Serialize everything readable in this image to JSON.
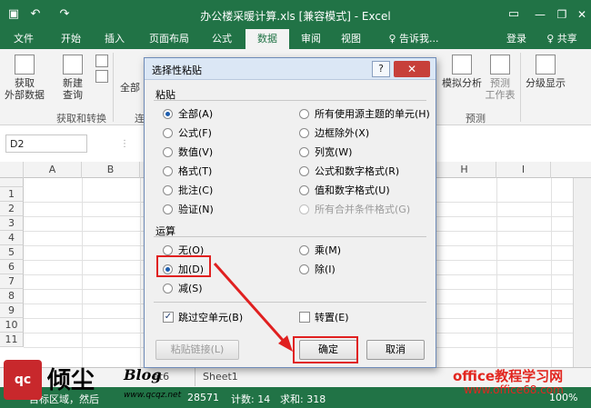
{
  "titlebar": {
    "save_icon": "save-icon",
    "undo_icon": "undo-icon",
    "redo_icon": "redo-icon",
    "title": "办公楼采暖计算.xls  [兼容模式] - Excel",
    "ribbon_display_icon": "ribbon-display-icon",
    "minimize": "—",
    "restore": "❐",
    "close": "✕"
  },
  "tabs": [
    "文件",
    "开始",
    "插入",
    "页面布局",
    "公式",
    "数据",
    "审阅",
    "视图"
  ],
  "tell_me": "♀ 告诉我...",
  "login": "登录",
  "share": "♀ 共享",
  "ribbon": {
    "get_external_data": "获取\n外部数据",
    "new_query": "新建\n查询",
    "refresh_all": "全部",
    "group_get_transform": "获取和转换",
    "group_conn_partial": "连",
    "what_if": "模拟分析",
    "forecast_sheet": "预测\n工作表",
    "group_forecast": "预测",
    "outline": "分级显示"
  },
  "namebox": "D2",
  "columns": [
    "A",
    "B",
    "H",
    "I"
  ],
  "rows": [
    "1",
    "2",
    "3",
    "4",
    "5",
    "6",
    "7",
    "8",
    "9",
    "10",
    "11"
  ],
  "sheet_tabs": [
    "et6",
    "Sheet1"
  ],
  "status": {
    "left": "目标区域，然后",
    "value_partial": "28571",
    "count": "计数: 14",
    "sum": "求和: 318",
    "zoom": "100%"
  },
  "dialog": {
    "title": "选择性粘贴",
    "help": "?",
    "close": "✕",
    "paste_section": "粘贴",
    "paste_options_left": [
      "全部(A)",
      "公式(F)",
      "数值(V)",
      "格式(T)",
      "批注(C)",
      "验证(N)"
    ],
    "paste_options_right": [
      "所有使用源主题的单元(H)",
      "边框除外(X)",
      "列宽(W)",
      "公式和数字格式(R)",
      "值和数字格式(U)",
      "所有合并条件格式(G)"
    ],
    "operation_section": "运算",
    "op_left": [
      "无(O)",
      "加(D)",
      "减(S)"
    ],
    "op_right": [
      "乘(M)",
      "除(I)"
    ],
    "skip_blanks": "跳过空单元(B)",
    "transpose": "转置(E)",
    "paste_link": "粘贴链接(L)",
    "ok": "确定",
    "cancel": "取消"
  },
  "watermarks": {
    "site_name": "office教程学习网",
    "site_url": "www.office68.com",
    "logo_text": "qc",
    "blog_cn": "倾尘",
    "blog_en": "Blog",
    "blog_url": "www.qcqz.net"
  },
  "colors": {
    "excel_green": "#217346",
    "highlight_red": "#e02020"
  }
}
